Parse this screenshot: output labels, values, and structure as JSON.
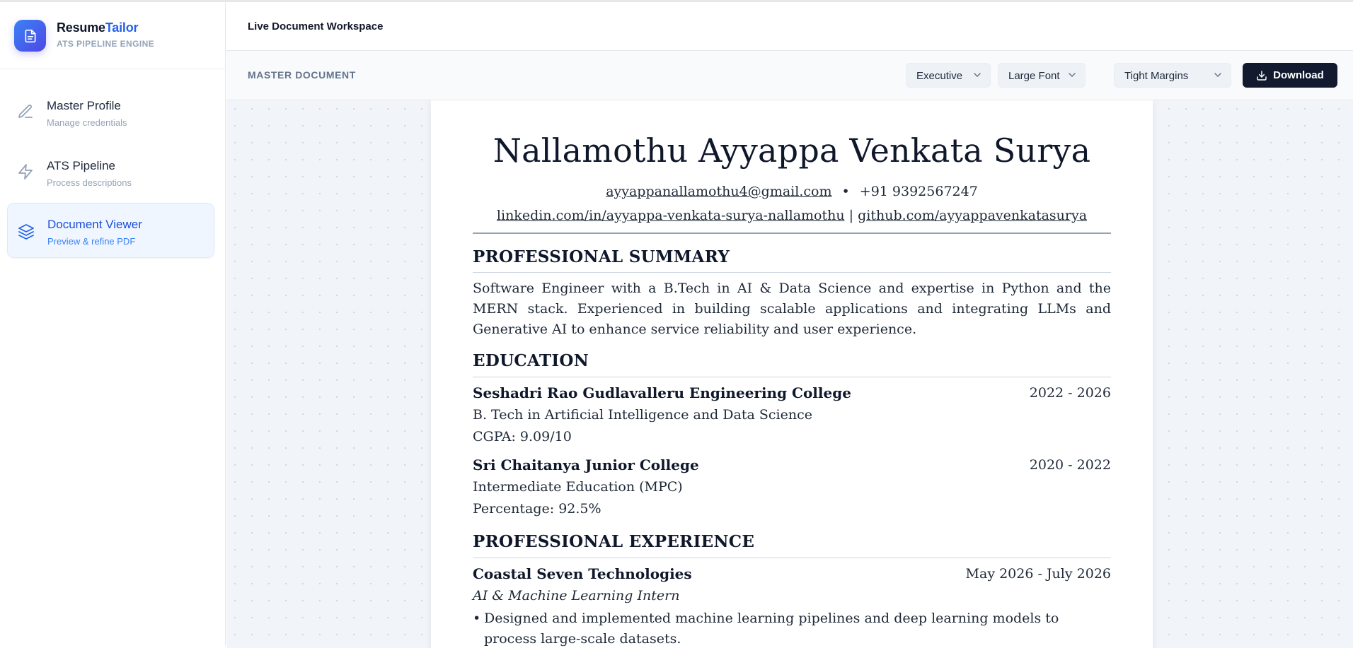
{
  "brand": {
    "name_part1": "Resume",
    "name_part2": "Tailor",
    "subtitle": "ATS PIPELINE ENGINE",
    "logo_icon": "document-icon",
    "accent_color": "#2563eb"
  },
  "sidebar": {
    "items": [
      {
        "label": "Master Profile",
        "sub": "Manage credentials",
        "icon": "pencil-icon",
        "active": false
      },
      {
        "label": "ATS Pipeline",
        "sub": "Process descriptions",
        "icon": "lightning-icon",
        "active": false
      },
      {
        "label": "Document Viewer",
        "sub": "Preview & refine PDF",
        "icon": "layers-icon",
        "active": true
      }
    ]
  },
  "header": {
    "title": "Live Document Workspace"
  },
  "toolbar": {
    "label": "MASTER DOCUMENT",
    "template_select": "Executive",
    "font_select": "Large Font",
    "margin_select": "Tight Margins",
    "download_label": "Download"
  },
  "resume": {
    "name": "Nallamothu Ayyappa Venkata Surya",
    "email": "ayyappanallamothu4@gmail.com",
    "separator": "•",
    "phone": "+91 9392567247",
    "linkedin": "linkedin.com/in/ayyappa-venkata-surya-nallamothu",
    "link_separator": "|",
    "github": "github.com/ayyappavenkatasurya",
    "summary_heading": "PROFESSIONAL SUMMARY",
    "summary": "Software Engineer with a B.Tech in AI & Data Science and expertise in Python and the MERN stack. Experienced in building scalable applications and integrating LLMs and Generative AI to enhance service reliability and user experience.",
    "education_heading": "EDUCATION",
    "education": [
      {
        "school": "Seshadri Rao Gudlavalleru Engineering College",
        "dates": "2022 - 2026",
        "degree": "B. Tech in Artificial Intelligence and Data Science",
        "score": "CGPA: 9.09/10"
      },
      {
        "school": "Sri Chaitanya Junior College",
        "dates": "2020 - 2022",
        "degree": "Intermediate Education (MPC)",
        "score": "Percentage: 92.5%"
      }
    ],
    "experience_heading": "PROFESSIONAL EXPERIENCE",
    "experience": [
      {
        "company": "Coastal Seven Technologies",
        "dates": "May 2026 - July 2026",
        "role": "AI & Machine Learning Intern",
        "bullets": [
          "Designed and implemented machine learning pipelines and deep learning models to process large-scale datasets."
        ]
      }
    ]
  }
}
